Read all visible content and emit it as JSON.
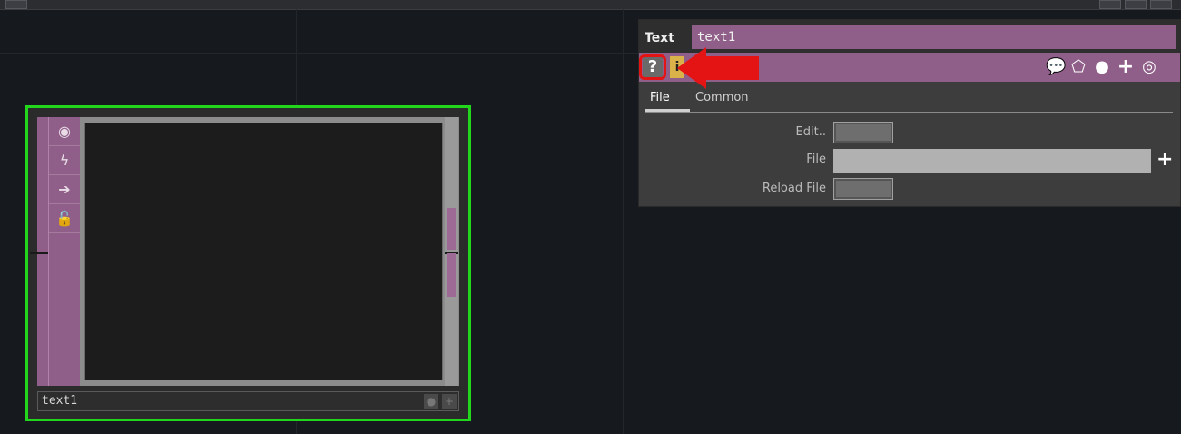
{
  "node": {
    "label": "text1",
    "side_icons": [
      "viewer-toggle-icon",
      "cook-icon",
      "arrow-right-icon",
      "lock-icon"
    ]
  },
  "panel": {
    "type_label": "Text",
    "name_value": "text1",
    "help_label": "?",
    "info_label": "i",
    "tabs": [
      "File",
      "Common"
    ],
    "params": [
      {
        "label": "Edit..",
        "kind": "button"
      },
      {
        "label": "File",
        "kind": "field",
        "value": ""
      },
      {
        "label": "Reload File",
        "kind": "button"
      }
    ],
    "toolbar_icons": [
      "comment-icon",
      "clone-icon",
      "python-icon",
      "add-icon",
      "target-icon"
    ]
  },
  "colors": {
    "accent_pink": "#8f5f89",
    "node_selected": "#22d61e",
    "annotation_red": "#e41414",
    "background": "#16191d"
  }
}
